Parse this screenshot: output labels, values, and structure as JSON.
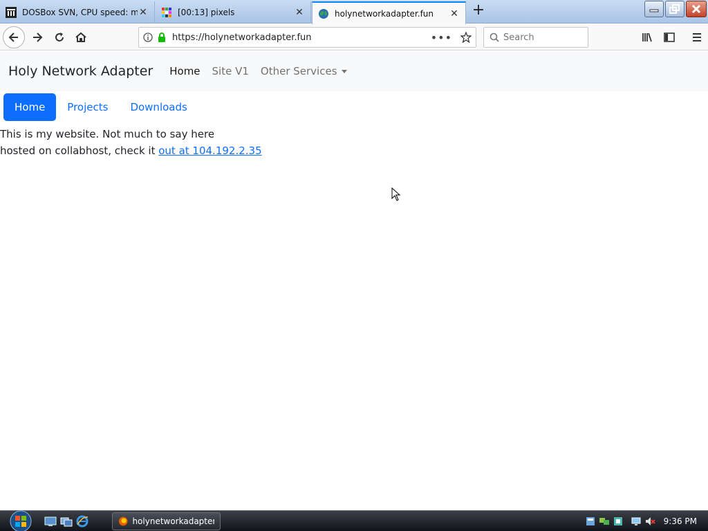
{
  "browser": {
    "tabs": [
      {
        "title": "DOSBox SVN, CPU speed: max",
        "icon": "dosbox-icon",
        "active": false
      },
      {
        "title": "[00:13] pixels",
        "icon": "pixels-grid-icon",
        "active": false
      },
      {
        "title": "holynetworkadapter.fun",
        "icon": "globe-icon",
        "active": true
      }
    ],
    "url": "https://holynetworkadapter.fun",
    "search_placeholder": "Search",
    "accent": "#0a84ff"
  },
  "site": {
    "brand": "Holy Network Adapter",
    "nav": [
      "Home",
      "Site V1",
      "Other Services"
    ],
    "pills": [
      "Home",
      "Projects",
      "Downloads"
    ],
    "line1": "This is my website. Not much to say here",
    "line2_prefix": "hosted on collabhost, check it ",
    "line2_link": "out at 104.192.2.35",
    "primary_color": "#0d6efd"
  },
  "taskbar": {
    "task_label": "holynetworkadapter...",
    "clock": "9:36 PM"
  }
}
